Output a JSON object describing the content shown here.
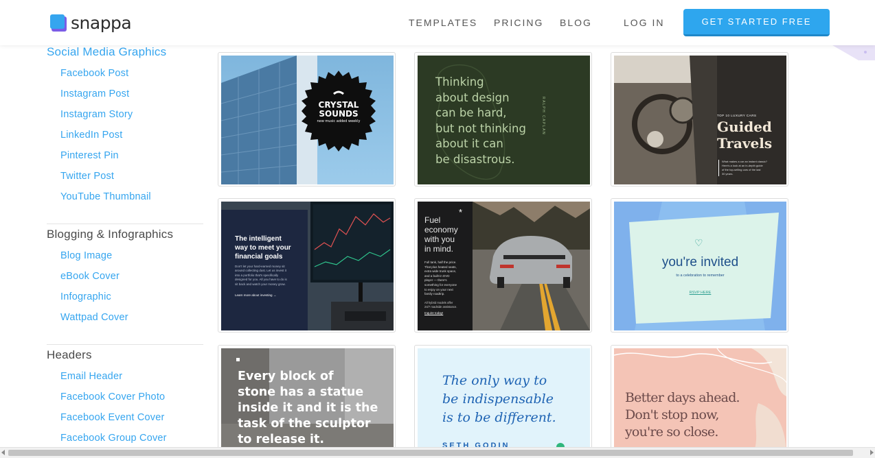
{
  "brand": {
    "name": "snappa"
  },
  "nav": {
    "templates": "TEMPLATES",
    "pricing": "PRICING",
    "blog": "BLOG",
    "login": "LOG IN",
    "cta": "GET STARTED FREE"
  },
  "colors": {
    "accent": "#35a5ef",
    "cta": "#2ea6ee",
    "logo_purple": "#7b5ce6"
  },
  "sidebar": {
    "social": {
      "title": "Social Media Graphics",
      "items": [
        "Facebook Post",
        "Instagram Post",
        "Instagram Story",
        "LinkedIn Post",
        "Pinterest Pin",
        "Twitter Post",
        "YouTube Thumbnail"
      ]
    },
    "blogging": {
      "title": "Blogging & Infographics",
      "items": [
        "Blog Image",
        "eBook Cover",
        "Infographic",
        "Wattpad Cover"
      ]
    },
    "headers": {
      "title": "Headers",
      "items": [
        "Email Header",
        "Facebook Cover Photo",
        "Facebook Event Cover",
        "Facebook Group Cover"
      ]
    }
  },
  "templates": {
    "t1": {
      "line1": "CRYSTAL",
      "line2": "SOUNDS",
      "sub": "new music added weekly"
    },
    "t2": {
      "quote": [
        "Thinking",
        "about design",
        "can be hard,",
        "but not thinking",
        "about it can",
        "be disastrous."
      ],
      "author": "RALPH CAPLAN"
    },
    "t3": {
      "kicker": "TOP 10 LUXURY CARS",
      "title1": "Guided",
      "title2": "Travels",
      "body": [
        "What makes a car an instant classic?",
        "Here's a look at an in-depth guide",
        "of the top-selling cars of the last",
        "30 years."
      ]
    },
    "t4": {
      "headline": [
        "The intelligent",
        "way to meet your",
        "financial goals"
      ],
      "body": [
        "Don't let your hard-earned money sit",
        "around collecting dust. Let us invest it",
        "into a portfolio that's specifically",
        "designed for you. All you have to do is",
        "sit back and watch your money grow."
      ],
      "link": "Learn more about investing"
    },
    "t5": {
      "headline": [
        "Fuel",
        "economy",
        "with you",
        "in mind."
      ],
      "body": [
        "Full tank, half the price.",
        "That plus heated seats,",
        "extra wide trunk space,",
        "and a built-in DVD",
        "player — there's",
        "something for everyone",
        "to enjoy on your next",
        "family roadtrip."
      ],
      "note": [
        "All hybrid models offer",
        "24/7 roadside assistance."
      ],
      "link": "Inquire today!"
    },
    "t6": {
      "title": "you're invited",
      "sub": "to a celebration to remember",
      "link": "RSVP HERE"
    },
    "t7": {
      "quote": [
        "Every block of",
        "stone has a statue",
        "inside it and it is the",
        "task of the sculptor",
        "to release it."
      ]
    },
    "t8": {
      "quote": [
        "The only way to",
        "be indispensable",
        "is to be different."
      ],
      "author": "SETH GODIN"
    },
    "t9": {
      "quote": [
        "Better days ahead.",
        "Don't stop now,",
        "you're so close."
      ]
    }
  }
}
